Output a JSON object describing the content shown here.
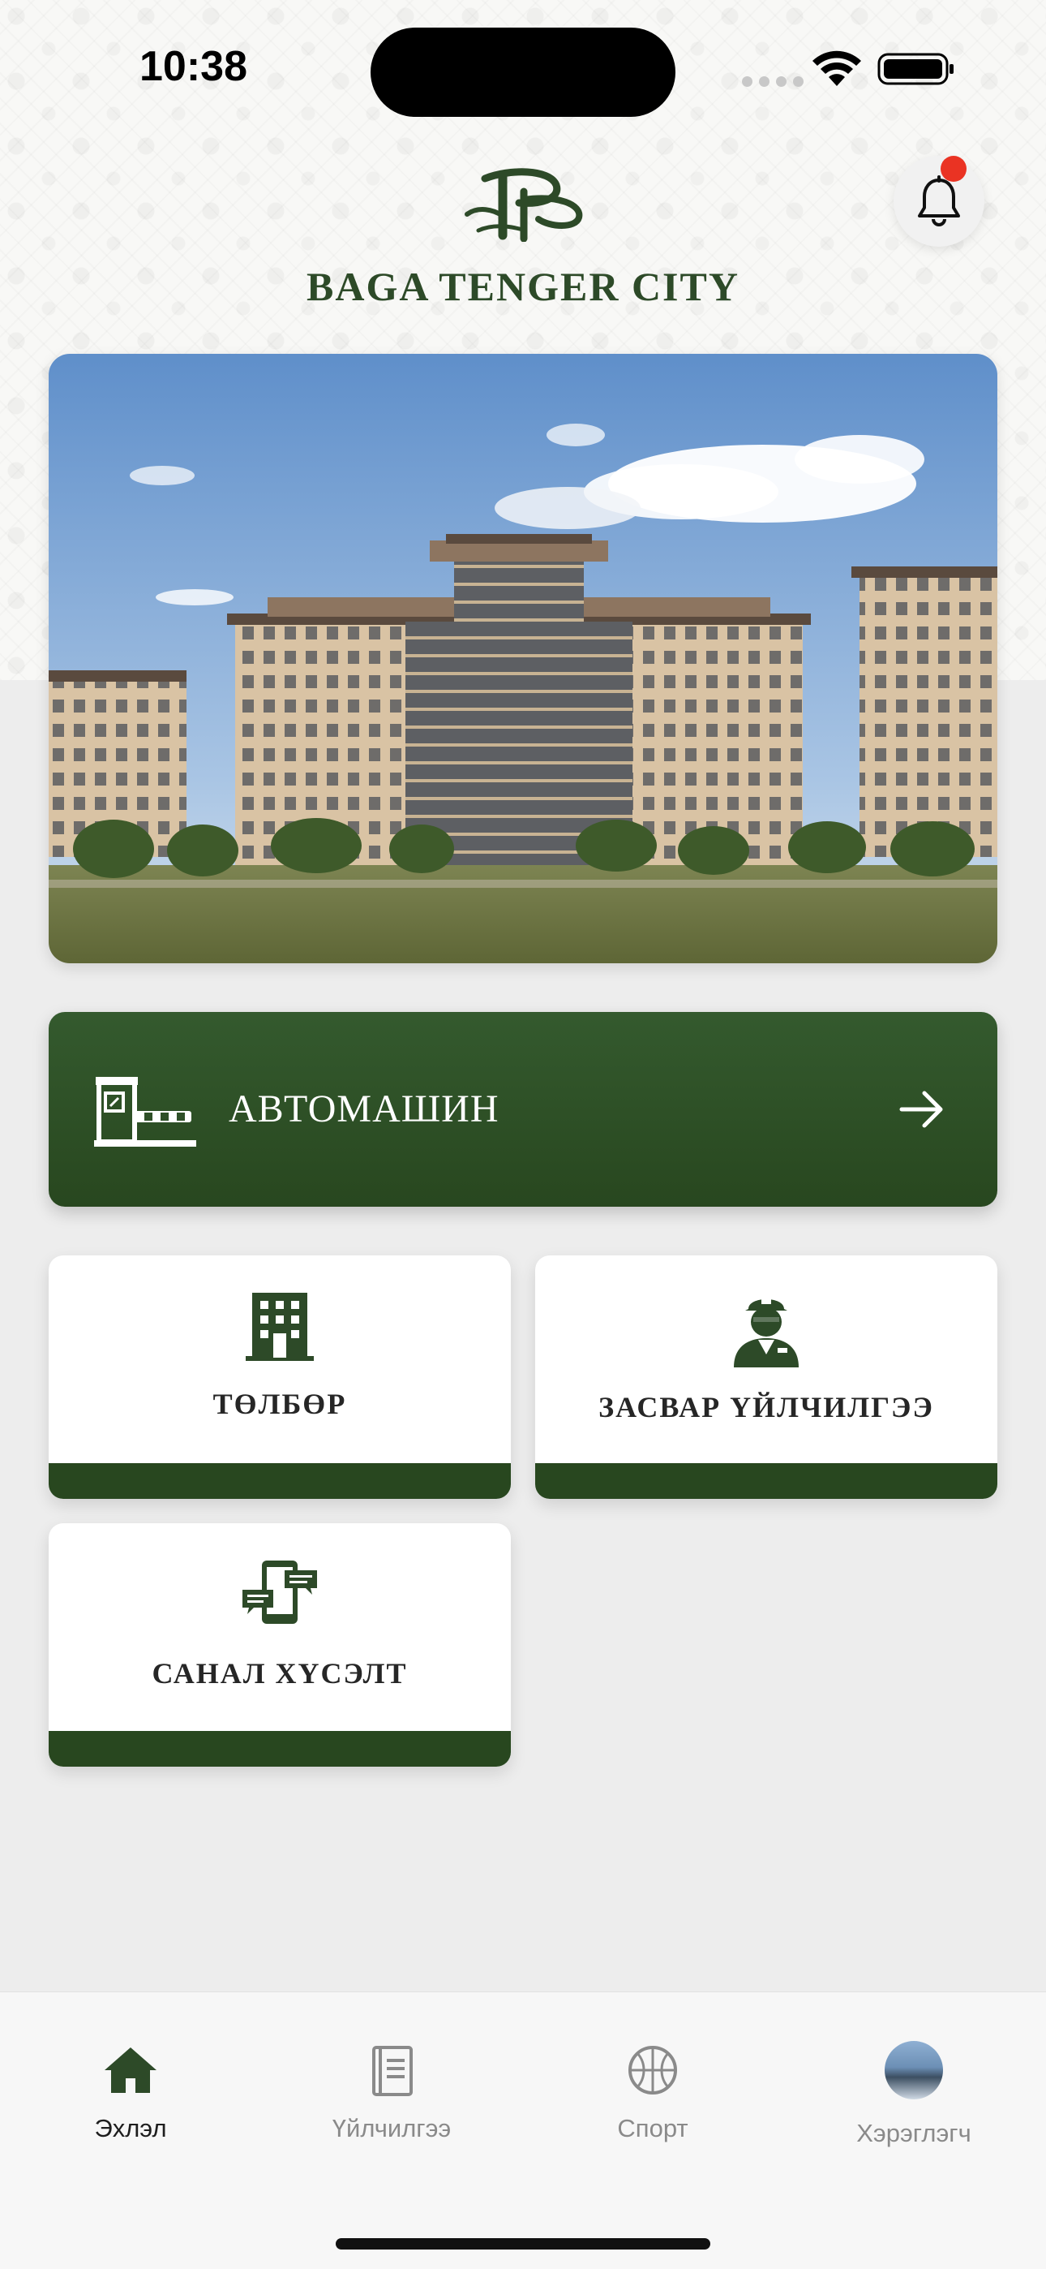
{
  "status_bar": {
    "time": "10:38"
  },
  "header": {
    "logo_text": "BAGA TENGER CITY",
    "logo_mark_icon": "bp-monogram-icon",
    "notification_icon": "bell-icon",
    "has_unread_badge": true
  },
  "hero": {
    "image": "residential-complex-photo"
  },
  "car_card": {
    "label": "АВТОМАШИН",
    "icon": "parking-barrier-icon",
    "action_icon": "arrow-right-icon"
  },
  "tiles": [
    {
      "label": "ТӨЛБӨР",
      "icon": "building-icon"
    },
    {
      "label": "ЗАСВАР ҮЙЛЧИЛГЭЭ",
      "icon": "repair-worker-icon"
    },
    {
      "label": "САНАЛ ХҮСЭЛТ",
      "icon": "chat-devices-icon"
    }
  ],
  "tab_bar": {
    "items": [
      {
        "label": "Эхлэл",
        "icon": "home-icon",
        "active": true
      },
      {
        "label": "Үйлчилгээ",
        "icon": "document-icon",
        "active": false
      },
      {
        "label": "Спорт",
        "icon": "basketball-icon",
        "active": false
      },
      {
        "label": "Хэрэглэгч",
        "icon": "user-avatar",
        "active": false
      }
    ]
  },
  "colors": {
    "brand_green": "#28471f",
    "brand_green_light": "#345a2e",
    "badge_red": "#ea3323",
    "background": "#ededed"
  }
}
